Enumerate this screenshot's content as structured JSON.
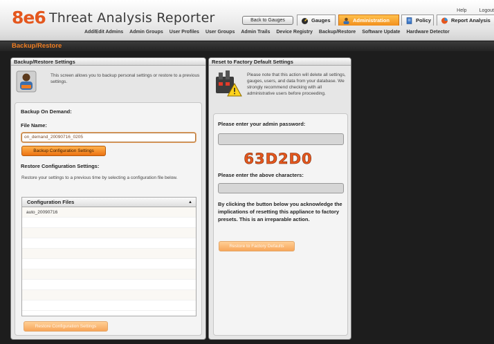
{
  "header": {
    "logo": "8e6",
    "app_title": "Threat Analysis Reporter",
    "top_links": [
      "Help",
      "Logout"
    ],
    "back_button": "Back to Gauges",
    "tabs": [
      {
        "label": "Gauges",
        "icon": "gauge-icon",
        "active": false
      },
      {
        "label": "Administration",
        "icon": "admin-icon",
        "active": true
      },
      {
        "label": "Policy",
        "icon": "policy-icon",
        "active": false
      },
      {
        "label": "Report Analysis",
        "icon": "report-analysis-icon",
        "active": false
      }
    ],
    "subnav": [
      "Add/Edit Admins",
      "Admin Groups",
      "User Profiles",
      "User Groups",
      "Admin Trails",
      "Device Registry",
      "Backup/Restore",
      "Software Update",
      "Hardware Detector"
    ]
  },
  "page_title": "Backup/Restore",
  "backup_panel": {
    "header": "Backup/Restore Settings",
    "intro": "This screen allows you to backup personal settings or restore to a previous settings.",
    "on_demand_label": "Backup On Demand:",
    "file_name_label": "File Name:",
    "file_name_value": "on_demand_20090716_0205",
    "backup_button": "Backup Configuration Settings",
    "restore_label": "Restore Configuration Settings:",
    "restore_desc": "Restore your settings to a previous time by selecting a configuration file below.",
    "table_header": "Configuration Files",
    "sort_indicator": "▲",
    "files": [
      "auto_20090716"
    ],
    "restore_button": "Restore Configuration Settings"
  },
  "factory_panel": {
    "header": "Reset to Factory Default Settings",
    "intro": "Please note that this action will delete all settings, gauges, users, and data from your database. We strongly recommend checking with all administrative users before proceeding.",
    "password_label": "Please enter your admin password:",
    "password_value": "",
    "captcha_text": "63D2D0",
    "captcha_label": "Please enter the above characters:",
    "captcha_value": "",
    "acknowledge": "By clicking the button below you acknowledge the implications of resetting this appliance to factory presets. This is an irreparable action.",
    "restore_button": "Restore to Factory Defaults"
  },
  "colors": {
    "accent": "#ef7d22",
    "brand": "#e4571e",
    "background": "#1d1d1d",
    "panel": "#e6e6e6"
  }
}
